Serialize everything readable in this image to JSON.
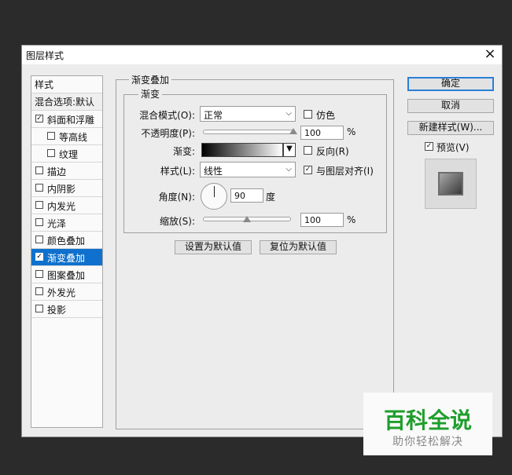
{
  "dialog": {
    "title": "图层样式",
    "close_glyph": "×"
  },
  "style_list": {
    "header": "样式",
    "blend_options": "混合选项:默认",
    "items": [
      {
        "label": "斜面和浮雕",
        "checked": true,
        "indent": false,
        "selected": false
      },
      {
        "label": "等高线",
        "checked": false,
        "indent": true,
        "selected": false
      },
      {
        "label": "纹理",
        "checked": false,
        "indent": true,
        "selected": false
      },
      {
        "label": "描边",
        "checked": false,
        "indent": false,
        "selected": false
      },
      {
        "label": "内阴影",
        "checked": false,
        "indent": false,
        "selected": false
      },
      {
        "label": "内发光",
        "checked": false,
        "indent": false,
        "selected": false
      },
      {
        "label": "光泽",
        "checked": false,
        "indent": false,
        "selected": false
      },
      {
        "label": "颜色叠加",
        "checked": false,
        "indent": false,
        "selected": false
      },
      {
        "label": "渐变叠加",
        "checked": true,
        "indent": false,
        "selected": true
      },
      {
        "label": "图案叠加",
        "checked": false,
        "indent": false,
        "selected": false
      },
      {
        "label": "外发光",
        "checked": false,
        "indent": false,
        "selected": false
      },
      {
        "label": "投影",
        "checked": false,
        "indent": false,
        "selected": false
      }
    ]
  },
  "panel": {
    "outer_legend": "渐变叠加",
    "inner_legend": "渐变",
    "blend_mode_label": "混合模式(O):",
    "blend_mode_value": "正常",
    "dither_label": "仿色",
    "opacity_label": "不透明度(P):",
    "opacity_value": "100",
    "opacity_percent": 100,
    "percent_sign": "%",
    "gradient_label": "渐变:",
    "reverse_label": "反向(R)",
    "style_label": "样式(L):",
    "style_value": "线性",
    "align_label": "与图层对齐(I)",
    "angle_label": "角度(N):",
    "angle_value": "90",
    "angle_unit": "度",
    "scale_label": "缩放(S):",
    "scale_value": "100",
    "scale_slider_fraction": 0.5,
    "make_default": "设置为默认值",
    "reset_default": "复位为默认值"
  },
  "buttons": {
    "ok": "确定",
    "cancel": "取消",
    "new_style": "新建样式(W)...",
    "preview_label": "预览(V)",
    "preview_checked": true
  },
  "watermark": {
    "title": "百科全说",
    "subtitle": "助你轻松解决",
    "color": "#1e9e2c"
  },
  "icons": {
    "dropdown": "chevron-down-icon",
    "check": "✓"
  }
}
